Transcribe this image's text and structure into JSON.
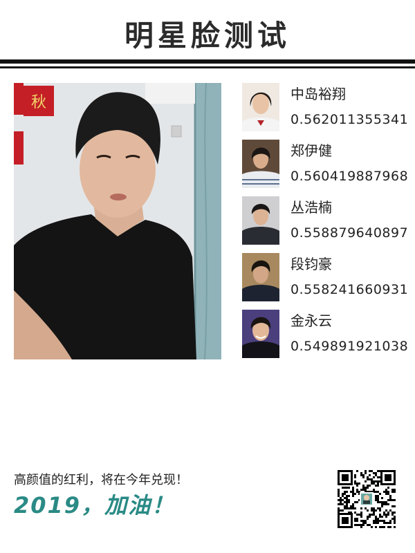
{
  "header": {
    "title": "明星脸测试"
  },
  "matches": [
    {
      "name": "中岛裕翔",
      "score": "0.562011355341"
    },
    {
      "name": "郑伊健",
      "score": "0.560419887968"
    },
    {
      "name": "丛浩楠",
      "score": "0.558879640897"
    },
    {
      "name": "段钧豪",
      "score": "0.558241660931"
    },
    {
      "name": "金永云",
      "score": "0.549891921038"
    }
  ],
  "photo_text": {
    "banner": "秋"
  },
  "footer": {
    "slogan": "高颜值的红利，将在今年兑现！",
    "cheer": "2019，加油！"
  },
  "colors": {
    "accent": "#2a8a85",
    "rule": "#111111"
  }
}
